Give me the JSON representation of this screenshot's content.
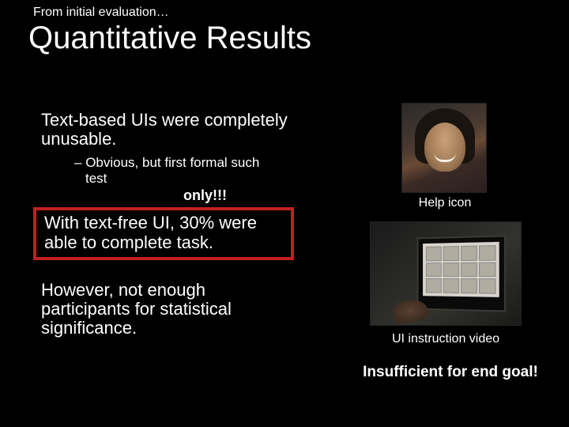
{
  "eyebrow": "From initial evaluation…",
  "title": "Quantitative Results",
  "left": {
    "point1": "Text-based UIs were completely unusable.",
    "sub1": "Obvious, but first formal such test",
    "only": "only!!!",
    "callout": "With text-free UI, 30% were able to complete task.",
    "point3": "However, not enough participants for statistical significance."
  },
  "right": {
    "caption1": "Help icon",
    "caption2": "UI instruction video",
    "footer": "Insufficient for end goal!"
  }
}
